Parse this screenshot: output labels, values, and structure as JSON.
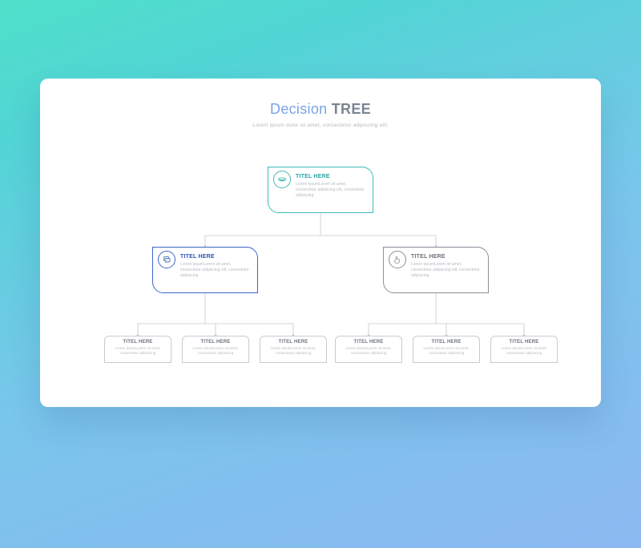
{
  "header": {
    "title_part1": "Decision ",
    "title_part2": "TREE",
    "subtitle": "Lorem ipsum dolor sit amet, consectetur adipiscing elit,"
  },
  "root": {
    "icon_name": "bowl-icon",
    "title": "TITEL HERE",
    "body": "Lorem ipsumLorem sit amet, consectetur adipiscing elit, consectetur adipiscing."
  },
  "children": [
    {
      "icon_name": "layers-icon",
      "title": "TITEL HERE",
      "body": "Lorem ipsumLorem sit amet, consectetur adipiscing elit, consectetur adipiscing."
    },
    {
      "icon_name": "hand-icon",
      "title": "TITEL HERE",
      "body": "Lorem ipsumLorem sit amet, consectetur adipiscing elit, consectetur adipiscing."
    }
  ],
  "leaves": [
    {
      "title": "TITEL HERE",
      "body": "Lorem ipsumLorem sit amet, consectetur adipiscing"
    },
    {
      "title": "TITEL HERE",
      "body": "Lorem ipsumLorem sit amet, consectetur adipiscing"
    },
    {
      "title": "TITEL HERE",
      "body": "Lorem ipsumLorem sit amet, consectetur adipiscing"
    },
    {
      "title": "TITEL HERE",
      "body": "Lorem ipsumLorem sit amet, consectetur adipiscing"
    },
    {
      "title": "TITEL HERE",
      "body": "Lorem ipsumLorem sit amet, consectetur adipiscing"
    },
    {
      "title": "TITEL HERE",
      "body": "Lorem ipsumLorem sit amet, consectetur adipiscing"
    }
  ]
}
